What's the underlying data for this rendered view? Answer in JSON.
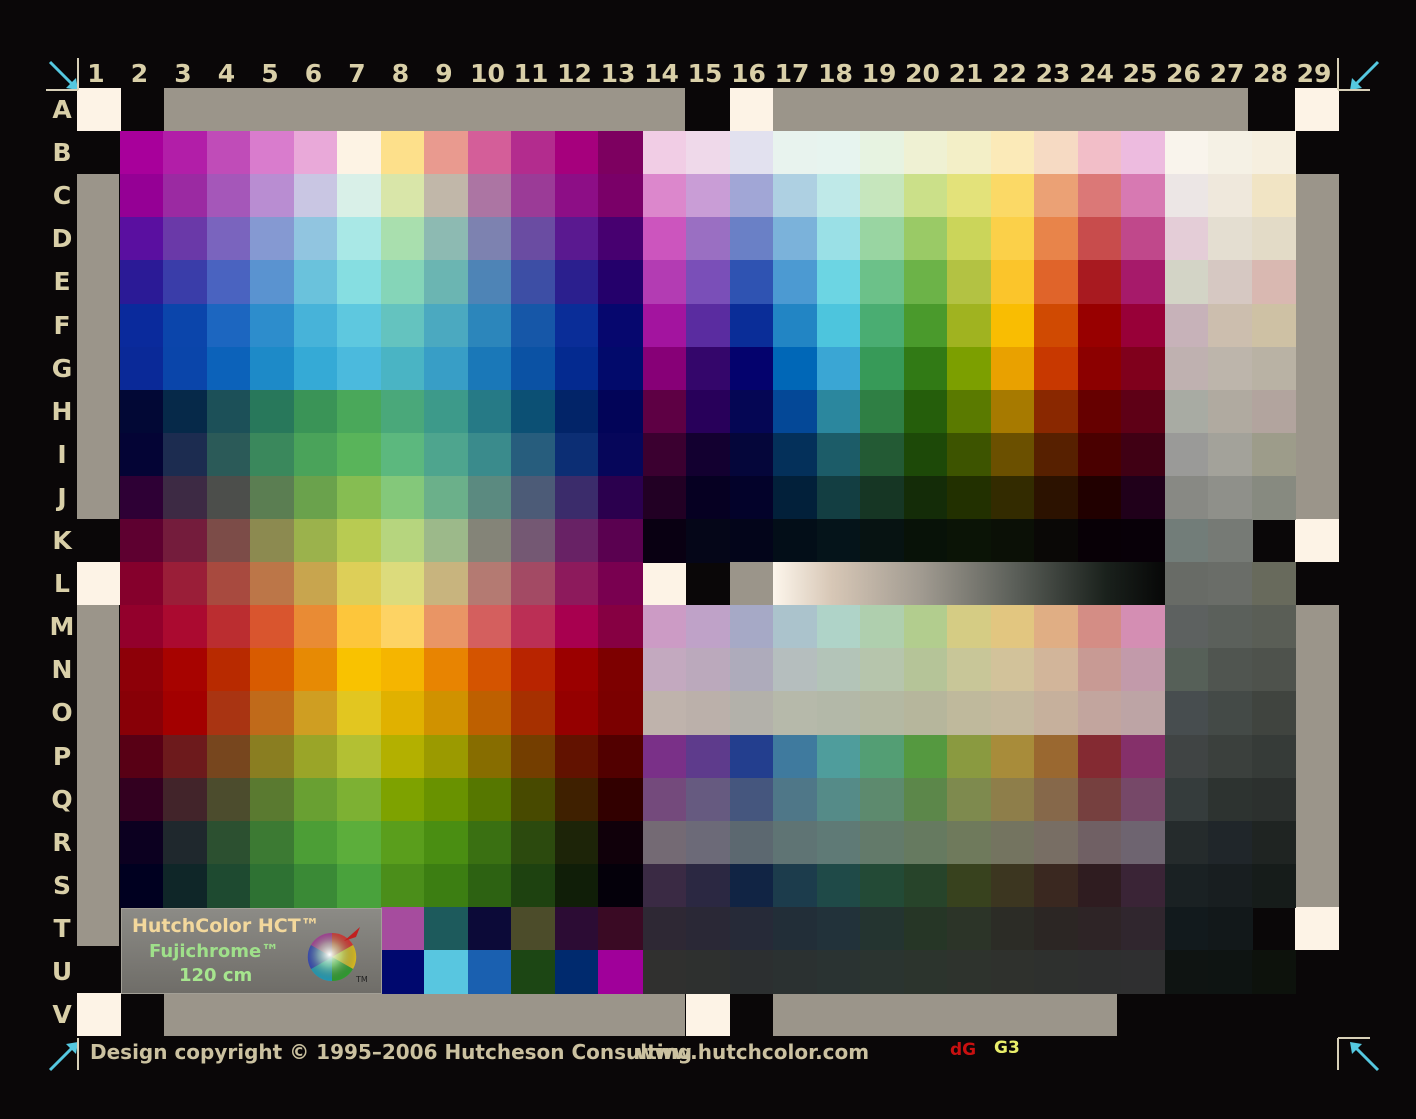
{
  "columns": [
    "1",
    "2",
    "3",
    "4",
    "5",
    "6",
    "7",
    "8",
    "9",
    "10",
    "11",
    "12",
    "13",
    "14",
    "15",
    "16",
    "17",
    "18",
    "19",
    "20",
    "21",
    "22",
    "23",
    "24",
    "25",
    "26",
    "27",
    "28",
    "29"
  ],
  "rows": [
    "A",
    "B",
    "C",
    "D",
    "E",
    "F",
    "G",
    "H",
    "I",
    "J",
    "K",
    "L",
    "M",
    "N",
    "O",
    "P",
    "Q",
    "R",
    "S",
    "T",
    "U",
    "V"
  ],
  "logo": {
    "line1": "HutchColor HCT™",
    "line2": "Fujichrome™",
    "line3": "120 cm",
    "tm": "TM"
  },
  "footer": {
    "copyright": "Design copyright © 1995–2006 Hutcheson Consulting",
    "website": "www.hutchcolor.com",
    "dg": "dG",
    "g3": "G3"
  },
  "colors": {
    "background": "#0a0708",
    "label": "#d9cfa8",
    "neutral_bar": "#9b958a",
    "corner_white": "#fdf3e6",
    "arrow": "#55c8e0"
  },
  "icons": [
    "corner-arrow-icon",
    "color-wheel-icon"
  ],
  "left_block_colors": [
    [
      "#a8009b",
      "#b21ea8",
      "#c04cb8",
      "#d97ccd",
      "#e9a9d9",
      "#fdf3e4",
      "#fde08b",
      "#e99a8f",
      "#d45e99",
      "#b32c8e",
      "#a6007d",
      "#7d0060"
    ],
    [
      "#950095",
      "#9b2aa2",
      "#a557b9",
      "#b98dd2",
      "#c9c6e3",
      "#d9f0e8",
      "#d9e6a9",
      "#c1b7a9",
      "#ac75a3",
      "#9b3b97",
      "#8d0e86",
      "#7a0068"
    ],
    [
      "#5a0fa0",
      "#6a39a8",
      "#7a64be",
      "#8599d2",
      "#91c5e0",
      "#a9e8e6",
      "#a9dfae",
      "#8dbab2",
      "#7d82b0",
      "#6a4ca2",
      "#5a1990",
      "#470070"
    ],
    [
      "#2b1a96",
      "#3a3da9",
      "#4a63c0",
      "#5a93d0",
      "#6ac2dc",
      "#86dee1",
      "#85d5b8",
      "#6bb5b2",
      "#4e84b6",
      "#3d4ea5",
      "#2b1f8e",
      "#24006b"
    ],
    [
      "#0a2a9c",
      "#0b45ab",
      "#1c66c0",
      "#2d8dcc",
      "#47b3d9",
      "#5ec8df",
      "#64c3bf",
      "#4ba9c0",
      "#2c86bb",
      "#1657a8",
      "#0a2d98",
      "#06076e"
    ],
    [
      "#0a2998",
      "#0a45aa",
      "#0c62ba",
      "#1d8ac8",
      "#35aad6",
      "#4bbadd",
      "#4ab4c4",
      "#389ec6",
      "#1a78b8",
      "#0b52a4",
      "#042a90",
      "#020a6b"
    ],
    [
      "#020835",
      "#062949",
      "#1c5058",
      "#28785b",
      "#3a9457",
      "#4aa85a",
      "#4aa87a",
      "#3d9a8a",
      "#267a86",
      "#0c5074",
      "#022468",
      "#020458"
    ],
    [
      "#040435",
      "#1c2c50",
      "#2b5a58",
      "#3a885c",
      "#4aa35a",
      "#59b45a",
      "#5cb87e",
      "#4ea58e",
      "#3a8b8c",
      "#275d7d",
      "#0c2e74",
      "#06065a"
    ],
    [
      "#2e0035",
      "#3d2a44",
      "#4c4e4b",
      "#5b7e52",
      "#6aa24c",
      "#86bd52",
      "#84c87a",
      "#6bb08a",
      "#5b8a80",
      "#4c5b77",
      "#3b2c6b",
      "#2b004e"
    ],
    [
      "#5e0030",
      "#741c3c",
      "#7c4c48",
      "#8c8a50",
      "#9bb24c",
      "#b8cb52",
      "#b6d57e",
      "#9cb98a",
      "#848478",
      "#745873",
      "#682265",
      "#5a0150"
    ],
    [
      "#85002c",
      "#9a1e38",
      "#a84a3f",
      "#bc7648",
      "#c8a54e",
      "#ddcf58",
      "#dcdb7c",
      "#c8b47e",
      "#b47a72",
      "#a34a64",
      "#8d1a5c",
      "#790050"
    ],
    [
      "#93002c",
      "#ab0a30",
      "#bb2d30",
      "#d9552e",
      "#e98b34",
      "#fdc63b",
      "#fdd364",
      "#e99565",
      "#d45f5e",
      "#bb2f55",
      "#a8004f",
      "#860042"
    ],
    [
      "#8d0008",
      "#a70300",
      "#b82a00",
      "#d85b00",
      "#e78a04",
      "#f9c200",
      "#f5b500",
      "#e88401",
      "#d45400",
      "#b82400",
      "#9b0000",
      "#7d0000"
    ],
    [
      "#880007",
      "#a30000",
      "#a93412",
      "#c06a1a",
      "#cf9e22",
      "#e2c620",
      "#e0b100",
      "#d09200",
      "#be6000",
      "#a63000",
      "#950000",
      "#7b0000"
    ],
    [
      "#580015",
      "#6d1a1c",
      "#77461e",
      "#8a7e21",
      "#9aa528",
      "#b3c033",
      "#b3b000",
      "#9b9a00",
      "#876d00",
      "#743e00",
      "#621200",
      "#520000"
    ],
    [
      "#330020",
      "#42242a",
      "#4c4c2d",
      "#5a7a30",
      "#69a032",
      "#7db133",
      "#7ea200",
      "#699200",
      "#567700",
      "#484a00",
      "#3f2000",
      "#320000"
    ],
    [
      "#0c0020",
      "#1f282d",
      "#2c5030",
      "#3c7a33",
      "#4c9e36",
      "#5cae3b",
      "#5a9e1c",
      "#4a8e12",
      "#3a7012",
      "#2c4a0e",
      "#1d2408",
      "#10000a"
    ],
    [
      "#000020",
      "#0f2628",
      "#1e4a30",
      "#2e7233",
      "#3a8a36",
      "#49a23c",
      "#4b8e1a",
      "#3c7e12",
      "#2d6212",
      "#1e4210",
      "#101e08",
      "#04000a"
    ]
  ],
  "right_block_colors": [
    [
      "#f1cde5",
      "#efd9ea",
      "#e2e1ef",
      "#e8f3ee",
      "#e7f4ef",
      "#e7f3e1",
      "#eff1d3",
      "#f3efc7",
      "#fbeab8",
      "#f6dac3",
      "#f2bec8",
      "#edbbdf"
    ],
    [
      "#dc87cc",
      "#c99dd6",
      "#a1a6d6",
      "#aed0e2",
      "#bfe9e8",
      "#c6e6bd",
      "#cbe089",
      "#e3e27a",
      "#fbd966",
      "#eba175",
      "#db7877",
      "#d779b2"
    ],
    [
      "#cc55be",
      "#9a6fc2",
      "#6a80c6",
      "#7bb2da",
      "#9ae0e6",
      "#99d5a2",
      "#9aca66",
      "#cbd55a",
      "#fbd049",
      "#e8844a",
      "#c84c4c",
      "#c0488b"
    ],
    [
      "#b33cb3",
      "#7a4fb8",
      "#2f53b2",
      "#4c9ad2",
      "#6cd5e3",
      "#6cc189",
      "#6cb348",
      "#b3c243",
      "#fbc52b",
      "#e0642a",
      "#a81a20",
      "#a61a6a"
    ],
    [
      "#a3149f",
      "#5a2ca0",
      "#0a2d98",
      "#2285c4",
      "#4dc5dd",
      "#4aad72",
      "#4a9a2c",
      "#a0b320",
      "#f9bd02",
      "#d04a02",
      "#980000",
      "#980038"
    ],
    [
      "#870077",
      "#34066b",
      "#04026d",
      "#0067b7",
      "#3aa6d4",
      "#379a58",
      "#317a15",
      "#7c9f00",
      "#e9a100",
      "#c83800",
      "#8c0000",
      "#80001c"
    ],
    [
      "#5e0044",
      "#28005a",
      "#050654",
      "#044897",
      "#2b879e",
      "#2f7f44",
      "#255e0b",
      "#5a7a00",
      "#a77a00",
      "#8a2800",
      "#660000",
      "#5e0016"
    ],
    [
      "#3b0030",
      "#130030",
      "#05063a",
      "#04305a",
      "#1c5c68",
      "#235a34",
      "#1d4908",
      "#3d5400",
      "#6b5000",
      "#572000",
      "#4a0000",
      "#400014"
    ],
    [
      "#220024",
      "#060022",
      "#03022a",
      "#02203a",
      "#133e42",
      "#163624",
      "#142c08",
      "#223000",
      "#332b00",
      "#2c1200",
      "#210000",
      "#20001a"
    ],
    [
      "#090012",
      "#050618",
      "#03051a",
      "#030e18",
      "#05141a",
      "#071312",
      "#081208",
      "#0b1406",
      "#0b1006",
      "#0a0806",
      "#080006",
      "#080008"
    ]
  ],
  "right_lower_colors": [
    [
      "#cc9bc5",
      "#bfa2c8",
      "#a6a9c6",
      "#abc3cc",
      "#afd3c8",
      "#afcfae",
      "#b2cd8e",
      "#d5cc84",
      "#e2c680",
      "#e0ae84",
      "#d48d85",
      "#d48eb3"
    ],
    [
      "#c3a9bf",
      "#bba9bc",
      "#aeabbb",
      "#b5bebe",
      "#b3c4b8",
      "#b6c5ac",
      "#b5c498",
      "#c8c698",
      "#d2c29a",
      "#d2b59a",
      "#c89a94",
      "#c29aaa"
    ],
    [
      "#bfb3ac",
      "#bbb0aa",
      "#b3b1aa",
      "#b6b9aa",
      "#b3b8a8",
      "#b4b8a2",
      "#b6b69c",
      "#bfb99c",
      "#c4b89d",
      "#c6b09c",
      "#c2a59e",
      "#bda4a5"
    ],
    [
      "#7a3088",
      "#5e3b8c",
      "#233e8e",
      "#3f7a9e",
      "#4f9d9c",
      "#539e74",
      "#559940",
      "#8a9a40",
      "#a88c3a",
      "#9a6830",
      "#842a32",
      "#85306a"
    ],
    [
      "#744a7c",
      "#665a80",
      "#45567e",
      "#4f7788",
      "#558b88",
      "#5d8a6e",
      "#5c874a",
      "#7e8a4e",
      "#8e7e4a",
      "#86684a",
      "#76403f",
      "#764868"
    ],
    [
      "#746a74",
      "#6c6a78",
      "#5c6870",
      "#5f7474",
      "#5f7a76",
      "#637a6a",
      "#667a60",
      "#6f7a5c",
      "#747460",
      "#786e64",
      "#706064",
      "#6e6470"
    ],
    [
      "#3a2a44",
      "#2b2842",
      "#112444",
      "#1c3c4c",
      "#1f4a48",
      "#234a36",
      "#27442a",
      "#38421e",
      "#3c3620",
      "#3a2820",
      "#2f1c20",
      "#3a2436"
    ],
    [
      "#2e2834",
      "#2a2836",
      "#262a38",
      "#222e38",
      "#22323a",
      "#243430",
      "#263626",
      "#2c3428",
      "#2c2c26",
      "#2c2624",
      "#2e2426",
      "#30262e"
    ],
    [
      "#30302f",
      "#2e302f",
      "#2c2f30",
      "#2b3131",
      "#2a3332",
      "#2b3430",
      "#2c342d",
      "#2e332d",
      "#2f312d",
      "#2e302e",
      "#2e2f2f",
      "#2f2f30"
    ]
  ],
  "gray_column_colors": [
    "#f9f4ec",
    "#ece6e5",
    "#e4cdd7",
    "#d3d4c6",
    "#c7b2b9",
    "#bfb1b0",
    "#a8aba3",
    "#9a9a98",
    "#888984",
    "#727d79",
    "#686b66",
    "#5d6160",
    "#566058",
    "#474d4f",
    "#404444",
    "#353c3c",
    "#252b2c",
    "#1a2123",
    "#121a1d",
    "#0f1412"
  ],
  "gray_column_colors_b": [
    "#f5f1e5",
    "#efe8dc",
    "#e4ded1",
    "#d6c8c2",
    "#ccbeae",
    "#bdb5ab",
    "#b0aaa0",
    "#a3a29a",
    "#8f908a",
    "#767a75",
    "#6a6d68",
    "#5b605b",
    "#505550",
    "#444a47",
    "#3b403d",
    "#2d3330",
    "#20262a",
    "#181e20",
    "#12181a",
    "#0e1412"
  ],
  "gray_column_colors_c": [
    "#f6efdf",
    "#f1e4c4",
    "#e3dbc7",
    "#d9b8b1",
    "#cec1a4",
    "#b9b2a4",
    "#b2a49e",
    "#9d9c8a",
    "#878a80",
    "#7a7970",
    "#686a5c",
    "#5a5e56",
    "#4e524c",
    "#40443f",
    "#363b38",
    "#2c302e",
    "#1f2422",
    "#161c1a",
    "#10150f",
    "#0d120c"
  ],
  "bottom_swatches": [
    "#a64c9e",
    "#1d5a5c",
    "#0c0a38",
    "#4c4c2a",
    "#2c0c34",
    "#3a0a24",
    "#00086e",
    "#58c6e0",
    "#1a60b0",
    "#1c4614",
    "#002a6e",
    "#a0009a"
  ]
}
